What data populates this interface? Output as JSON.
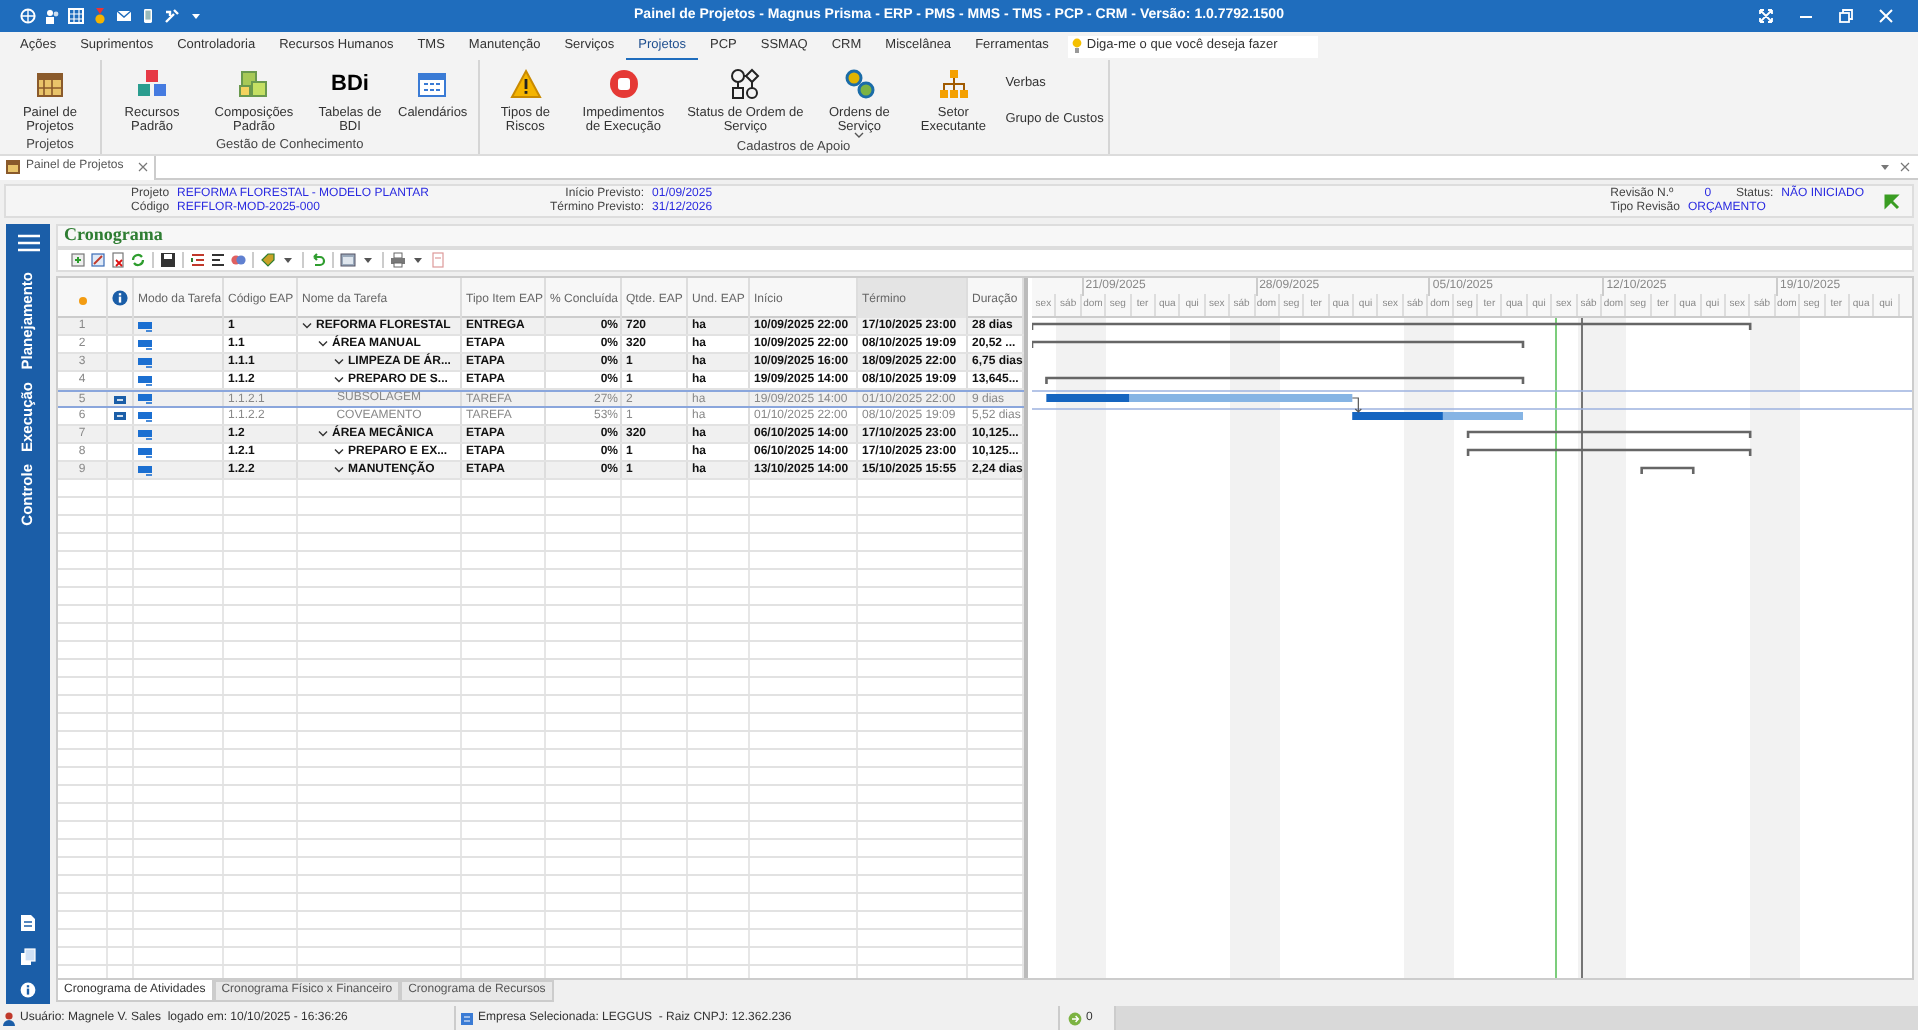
{
  "window": {
    "title": "Painel de Projetos - Magnus Prisma - ERP - PMS - MMS - TMS - PCP - CRM - Versão: 1.0.7792.1500"
  },
  "menu_tabs": [
    {
      "label": "Ações",
      "selected": false
    },
    {
      "label": "Suprimentos",
      "selected": false
    },
    {
      "label": "Controladoria",
      "selected": false
    },
    {
      "label": "Recursos Humanos",
      "selected": false
    },
    {
      "label": "TMS",
      "selected": false
    },
    {
      "label": "Manutenção",
      "selected": false
    },
    {
      "label": "Serviços",
      "selected": false
    },
    {
      "label": "Projetos",
      "selected": true
    },
    {
      "label": "PCP",
      "selected": false
    },
    {
      "label": "SSMAQ",
      "selected": false
    },
    {
      "label": "CRM",
      "selected": false
    },
    {
      "label": "Miscelânea",
      "selected": false
    },
    {
      "label": "Ferramentas",
      "selected": false
    }
  ],
  "search": {
    "placeholder": "Diga-me o que você deseja fazer"
  },
  "ribbon_groups": [
    {
      "label": "Projetos",
      "buttons": [
        {
          "kind": "large",
          "label": "Painel de Projetos",
          "dropdown": false
        }
      ]
    },
    {
      "label": "Gestão de Conhecimento",
      "buttons": [
        {
          "kind": "large",
          "label": "Recursos Padrão",
          "dropdown": false
        },
        {
          "kind": "large",
          "label": "Composições Padrão",
          "dropdown": false
        },
        {
          "kind": "large",
          "label": "Tabelas de BDI",
          "icon_text": "BDi",
          "dropdown": false
        },
        {
          "kind": "large",
          "label": "Calendários",
          "dropdown": false
        }
      ]
    },
    {
      "label": "Cadastros de Apoio",
      "buttons": [
        {
          "kind": "large",
          "label": "Tipos de Riscos",
          "dropdown": false
        },
        {
          "kind": "large",
          "label": "Impedimentos de Execução",
          "dropdown": false
        },
        {
          "kind": "large",
          "label": "Status de Ordem de Serviço",
          "dropdown": false
        },
        {
          "kind": "large",
          "label": "Ordens de Serviço",
          "dropdown": true
        },
        {
          "kind": "large",
          "label": "Setor Executante",
          "dropdown": false
        },
        {
          "kind": "small",
          "label": "Verbas",
          "dropdown": false
        },
        {
          "kind": "small",
          "label": "Grupo de Custos",
          "dropdown": false
        }
      ]
    }
  ],
  "document_tabs": [
    {
      "label": "Painel de Projetos",
      "selected": true
    }
  ],
  "project": {
    "left": [
      {
        "label": "Projeto",
        "value": "REFORMA FLORESTAL - MODELO PLANTAR"
      },
      {
        "label": "Código",
        "value": "REFFLOR-MOD-2025-000"
      }
    ],
    "middle": [
      {
        "label": "Início Previsto:",
        "value": "01/09/2025"
      },
      {
        "label": "Término Previsto:",
        "value": "31/12/2026"
      }
    ],
    "revision_label": "Revisão N.º",
    "revision": "0",
    "status_label": "Status:",
    "status": "NÃO INICIADO",
    "type_label": "Tipo Revisão",
    "type": "ORÇAMENTO"
  },
  "sidebar": {
    "items": [
      {
        "label": "Planejamento"
      },
      {
        "label": "Execução"
      },
      {
        "label": "Controle"
      }
    ]
  },
  "section_title": "Cronograma",
  "table": {
    "columns": [
      "Modo da Tarefa",
      "Código EAP",
      "Nome da Tarefa",
      "Tipo Item EAP",
      "% Concluída",
      "Qtde. EAP",
      "Und. EAP",
      "Início",
      "Término",
      "Duração"
    ],
    "rows": [
      {
        "number": "1",
        "code": "1",
        "name": "REFORMA FLORESTAL",
        "type": "ENTREGA",
        "percent": "0%",
        "qty": "720",
        "unit": "ha",
        "start": "10/09/2025 22:00",
        "end": "17/10/2025 23:00",
        "duration": "28 dias",
        "selected": false,
        "expanded": true,
        "children": [
          {
            "number": "2",
            "code": "1.1",
            "name": "ÁREA MANUAL",
            "type": "ETAPA",
            "percent": "0%",
            "qty": "320",
            "unit": "ha",
            "start": "10/09/2025 22:00",
            "end": "08/10/2025 19:09",
            "duration": "20,52 ...",
            "selected": false,
            "expanded": true,
            "children": [
              {
                "number": "3",
                "code": "1.1.1",
                "name": "LIMPEZA DE ÁR...",
                "type": "ETAPA",
                "percent": "0%",
                "qty": "1",
                "unit": "ha",
                "start": "10/09/2025 16:00",
                "end": "18/09/2025 22:00",
                "duration": "6,75 dias",
                "selected": false,
                "expanded": true
              },
              {
                "number": "4",
                "code": "1.1.2",
                "name": "PREPARO DE S...",
                "type": "ETAPA",
                "percent": "0%",
                "qty": "1",
                "unit": "ha",
                "start": "19/09/2025 14:00",
                "end": "08/10/2025 19:09",
                "duration": "13,645...",
                "selected": false,
                "expanded": true,
                "children": [
                  {
                    "number": "5",
                    "code": "1.1.2.1",
                    "name": "SUBSOLAGEM",
                    "type": "TAREFA",
                    "percent": "27%",
                    "level": 0.27,
                    "qty": "2",
                    "unit": "ha",
                    "start": "19/09/2025 14:00",
                    "end": "01/10/2025 22:00",
                    "duration": "9 dias",
                    "selected": true
                  },
                  {
                    "number": "6",
                    "code": "1.1.2.2",
                    "name": "COVEAMENTO",
                    "type": "TAREFA",
                    "percent": "53%",
                    "level": 0.53,
                    "qty": "1",
                    "unit": "ha",
                    "start": "01/10/2025 22:00",
                    "end": "08/10/2025 19:09",
                    "duration": "5,52 dias",
                    "selected": false
                  }
                ]
              }
            ]
          },
          {
            "number": "7",
            "code": "1.2",
            "name": "ÁREA MECÂNICA",
            "type": "ETAPA",
            "percent": "0%",
            "qty": "320",
            "unit": "ha",
            "start": "06/10/2025 14:00",
            "end": "17/10/2025 23:00",
            "duration": "10,125...",
            "selected": false,
            "expanded": true,
            "children": [
              {
                "number": "8",
                "code": "1.2.1",
                "name": "PREPARO E EX...",
                "type": "ETAPA",
                "percent": "0%",
                "qty": "1",
                "unit": "ha",
                "start": "06/10/2025 14:00",
                "end": "17/10/2025 23:00",
                "duration": "10,125...",
                "selected": false,
                "expanded": true
              },
              {
                "number": "9",
                "code": "1.2.2",
                "name": "MANUTENÇÃO",
                "type": "ETAPA",
                "percent": "0%",
                "qty": "1",
                "unit": "ha",
                "start": "13/10/2025 14:00",
                "end": "15/10/2025 15:55",
                "duration": "2,24 dias",
                "selected": false,
                "expanded": true
              }
            ]
          }
        ]
      }
    ]
  },
  "gantt": {
    "weeks": [
      "21/09/2025",
      "28/09/2025",
      "05/10/2025",
      "12/10/2025",
      "19/10/2025"
    ],
    "days": [
      "sex",
      "sáb",
      "dom",
      "seg",
      "ter",
      "qua",
      "qui",
      "sex",
      "sáb",
      "dom",
      "seg",
      "ter",
      "qua",
      "qui",
      "sex",
      "sáb",
      "dom",
      "seg",
      "ter",
      "qua",
      "qui",
      "sex",
      "sáb",
      "dom",
      "seg",
      "ter",
      "qua",
      "qui",
      "sex",
      "sáb",
      "dom",
      "seg",
      "ter",
      "qua",
      "qui"
    ]
  },
  "bottom_tabs": [
    {
      "label": "Cronograma de Atividades",
      "selected": true
    },
    {
      "label": "Cronograma Físico x Financeiro",
      "selected": false
    },
    {
      "label": "Cronograma de Recursos",
      "selected": false
    }
  ],
  "status_bar": {
    "user": "Usuário: Magnele V. Sales  logado em: 10/10/2025 - 16:36:26",
    "company": "Empresa Selecionada: LEGGUS  - Raiz CNPJ: 12.362.236",
    "count": "0"
  }
}
